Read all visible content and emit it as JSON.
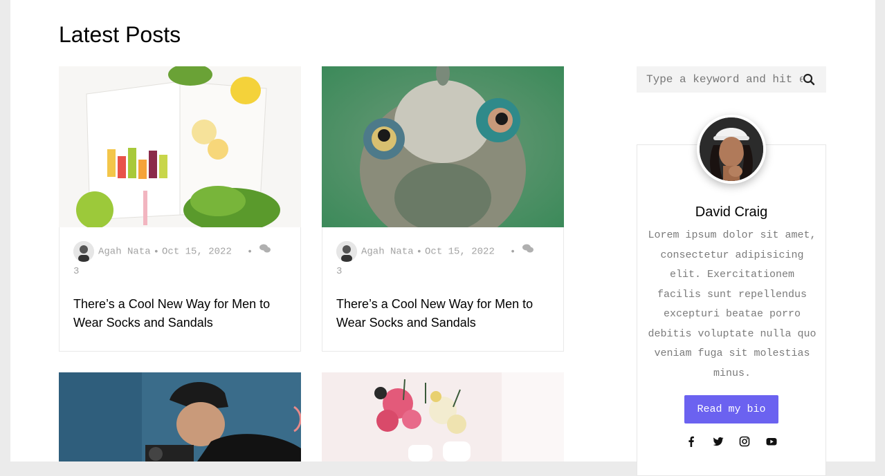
{
  "section": {
    "title": "Latest Posts"
  },
  "posts": [
    {
      "author": "Agah Nata",
      "date": "Oct 15, 2022",
      "bullet": "•",
      "comments": "3",
      "title": "There’s a Cool New Way for Men to Wear Socks and Sandals",
      "image": "smoothie-book-photo"
    },
    {
      "author": "Agah Nata",
      "date": "Oct 15, 2022",
      "bullet": "•",
      "comments": "3",
      "title": "There’s a Cool New Way for Men to Wear Socks and Sandals",
      "image": "chameleon-photo"
    },
    {
      "image": "cameraman-photo"
    },
    {
      "image": "flowers-vases-photo"
    }
  ],
  "search": {
    "placeholder": "Type a keyword and hit enter",
    "icon": "search-icon"
  },
  "bio": {
    "name": "David Craig",
    "text": "Lorem ipsum dolor sit amet, consectetur adipisicing elit. Exercitationem facilis sunt repellendus excepturi beatae porro debitis voluptate nulla quo veniam fuga sit molestias minus.",
    "button_label": "Read my bio",
    "socials": [
      "facebook-icon",
      "twitter-icon",
      "instagram-icon",
      "youtube-icon"
    ]
  },
  "colors": {
    "accent": "#6b62f0",
    "meta_text": "#a3a3a3",
    "search_bg": "#f3f3f3"
  }
}
